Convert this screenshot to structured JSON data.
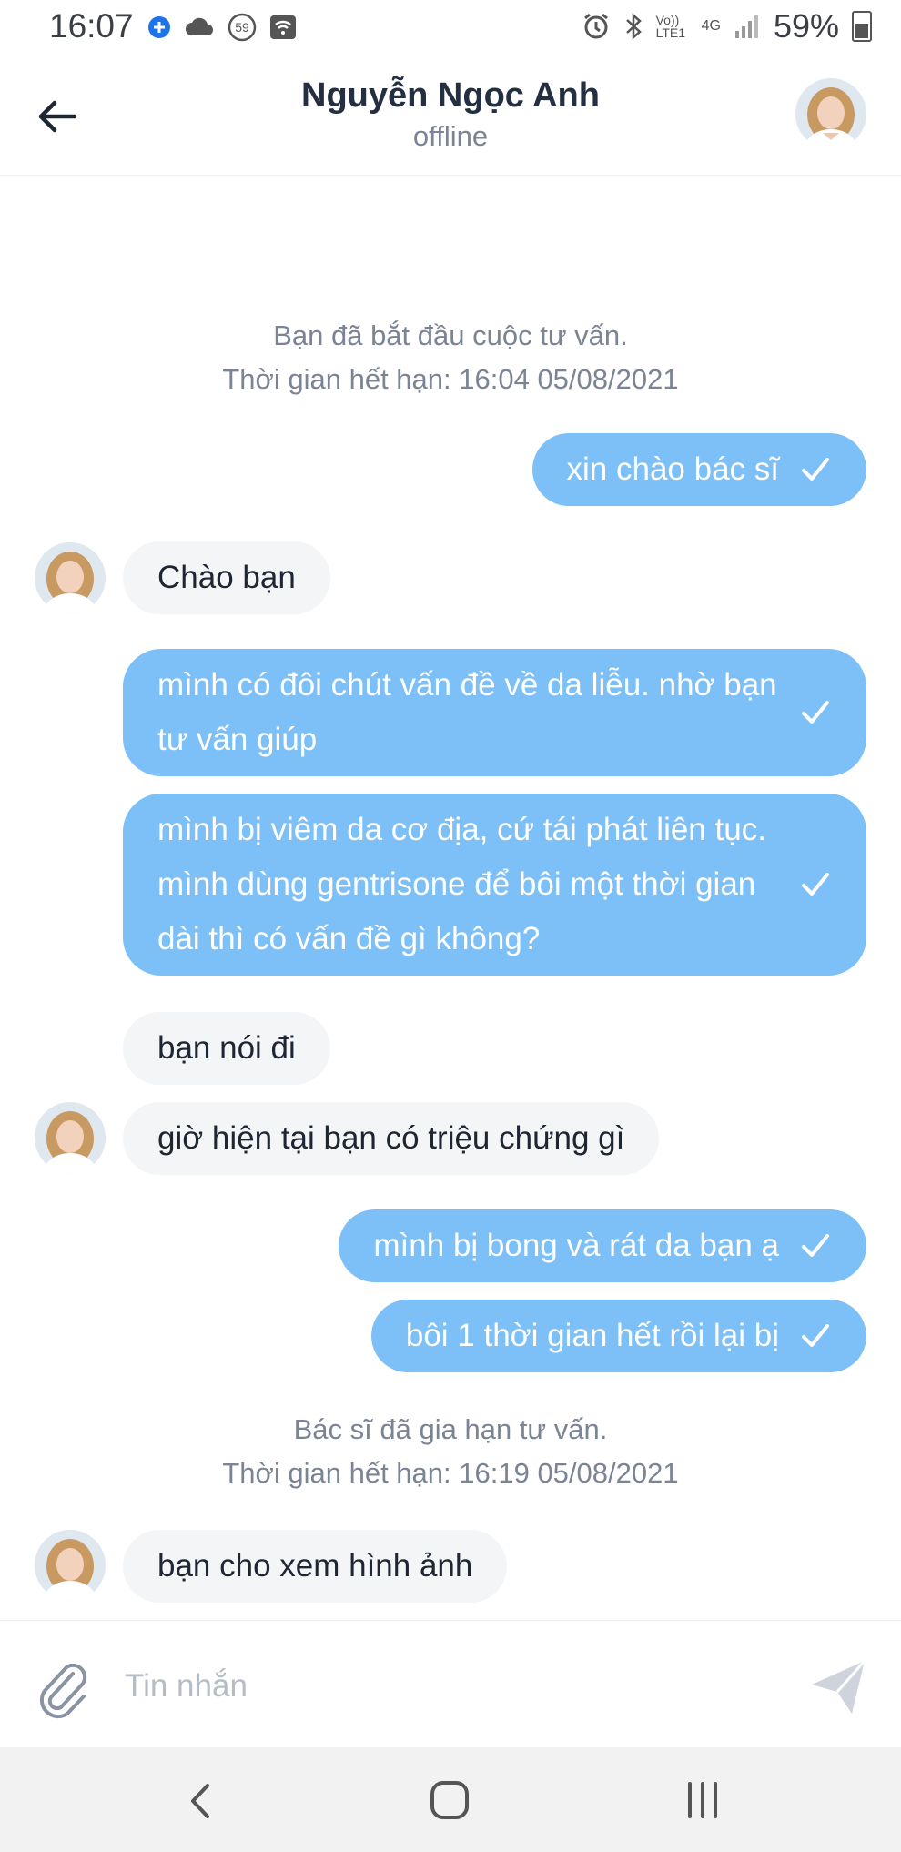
{
  "status_bar": {
    "time": "16:07",
    "battery": "59%",
    "icons": [
      "shield-plus-icon",
      "cloud-sync-icon",
      "notification-count-icon",
      "wifi-box-icon",
      "alarm-icon",
      "bluetooth-icon",
      "volte-icon",
      "4g-icon",
      "signal-icon",
      "battery-icon"
    ],
    "notif_count": "59",
    "volte_label": "Vo)) LTE1",
    "net_label": "4G"
  },
  "header": {
    "name": "Nguyễn Ngọc Anh",
    "status": "offline"
  },
  "messages": [
    {
      "type": "system",
      "lines": [
        "Bạn đã bắt đầu cuộc tư vấn.",
        "Thời gian hết hạn: 16:04 05/08/2021"
      ]
    },
    {
      "type": "out",
      "text": "xin chào bác sĩ"
    },
    {
      "type": "in",
      "text": "Chào bạn"
    },
    {
      "type": "out",
      "text": "mình có đôi chút vấn đề về da liễu. nhờ bạn tư vấn giúp"
    },
    {
      "type": "out",
      "text": "mình bị viêm da cơ địa, cứ tái phát liên tục. mình dùng gentrisone để bôi một thời gian dài thì có vấn đề gì không?"
    },
    {
      "type": "in",
      "text": "bạn nói đi"
    },
    {
      "type": "in",
      "text": "giờ hiện tại bạn có triệu chứng gì"
    },
    {
      "type": "out",
      "text": "mình bị bong và rát da bạn ạ"
    },
    {
      "type": "out",
      "text": "bôi 1 thời gian hết rồi lại bị"
    },
    {
      "type": "system",
      "lines": [
        "Bác sĩ đã gia hạn tư vấn.",
        "Thời gian hết hạn: 16:19 05/08/2021"
      ]
    },
    {
      "type": "in",
      "text": "bạn cho xem hình ảnh"
    }
  ],
  "composer": {
    "placeholder": "Tin nhắn"
  },
  "colors": {
    "outgoing_bubble": "#7cc0f7",
    "incoming_bubble": "#f4f5f7",
    "title": "#243042",
    "muted": "#7b8494"
  }
}
